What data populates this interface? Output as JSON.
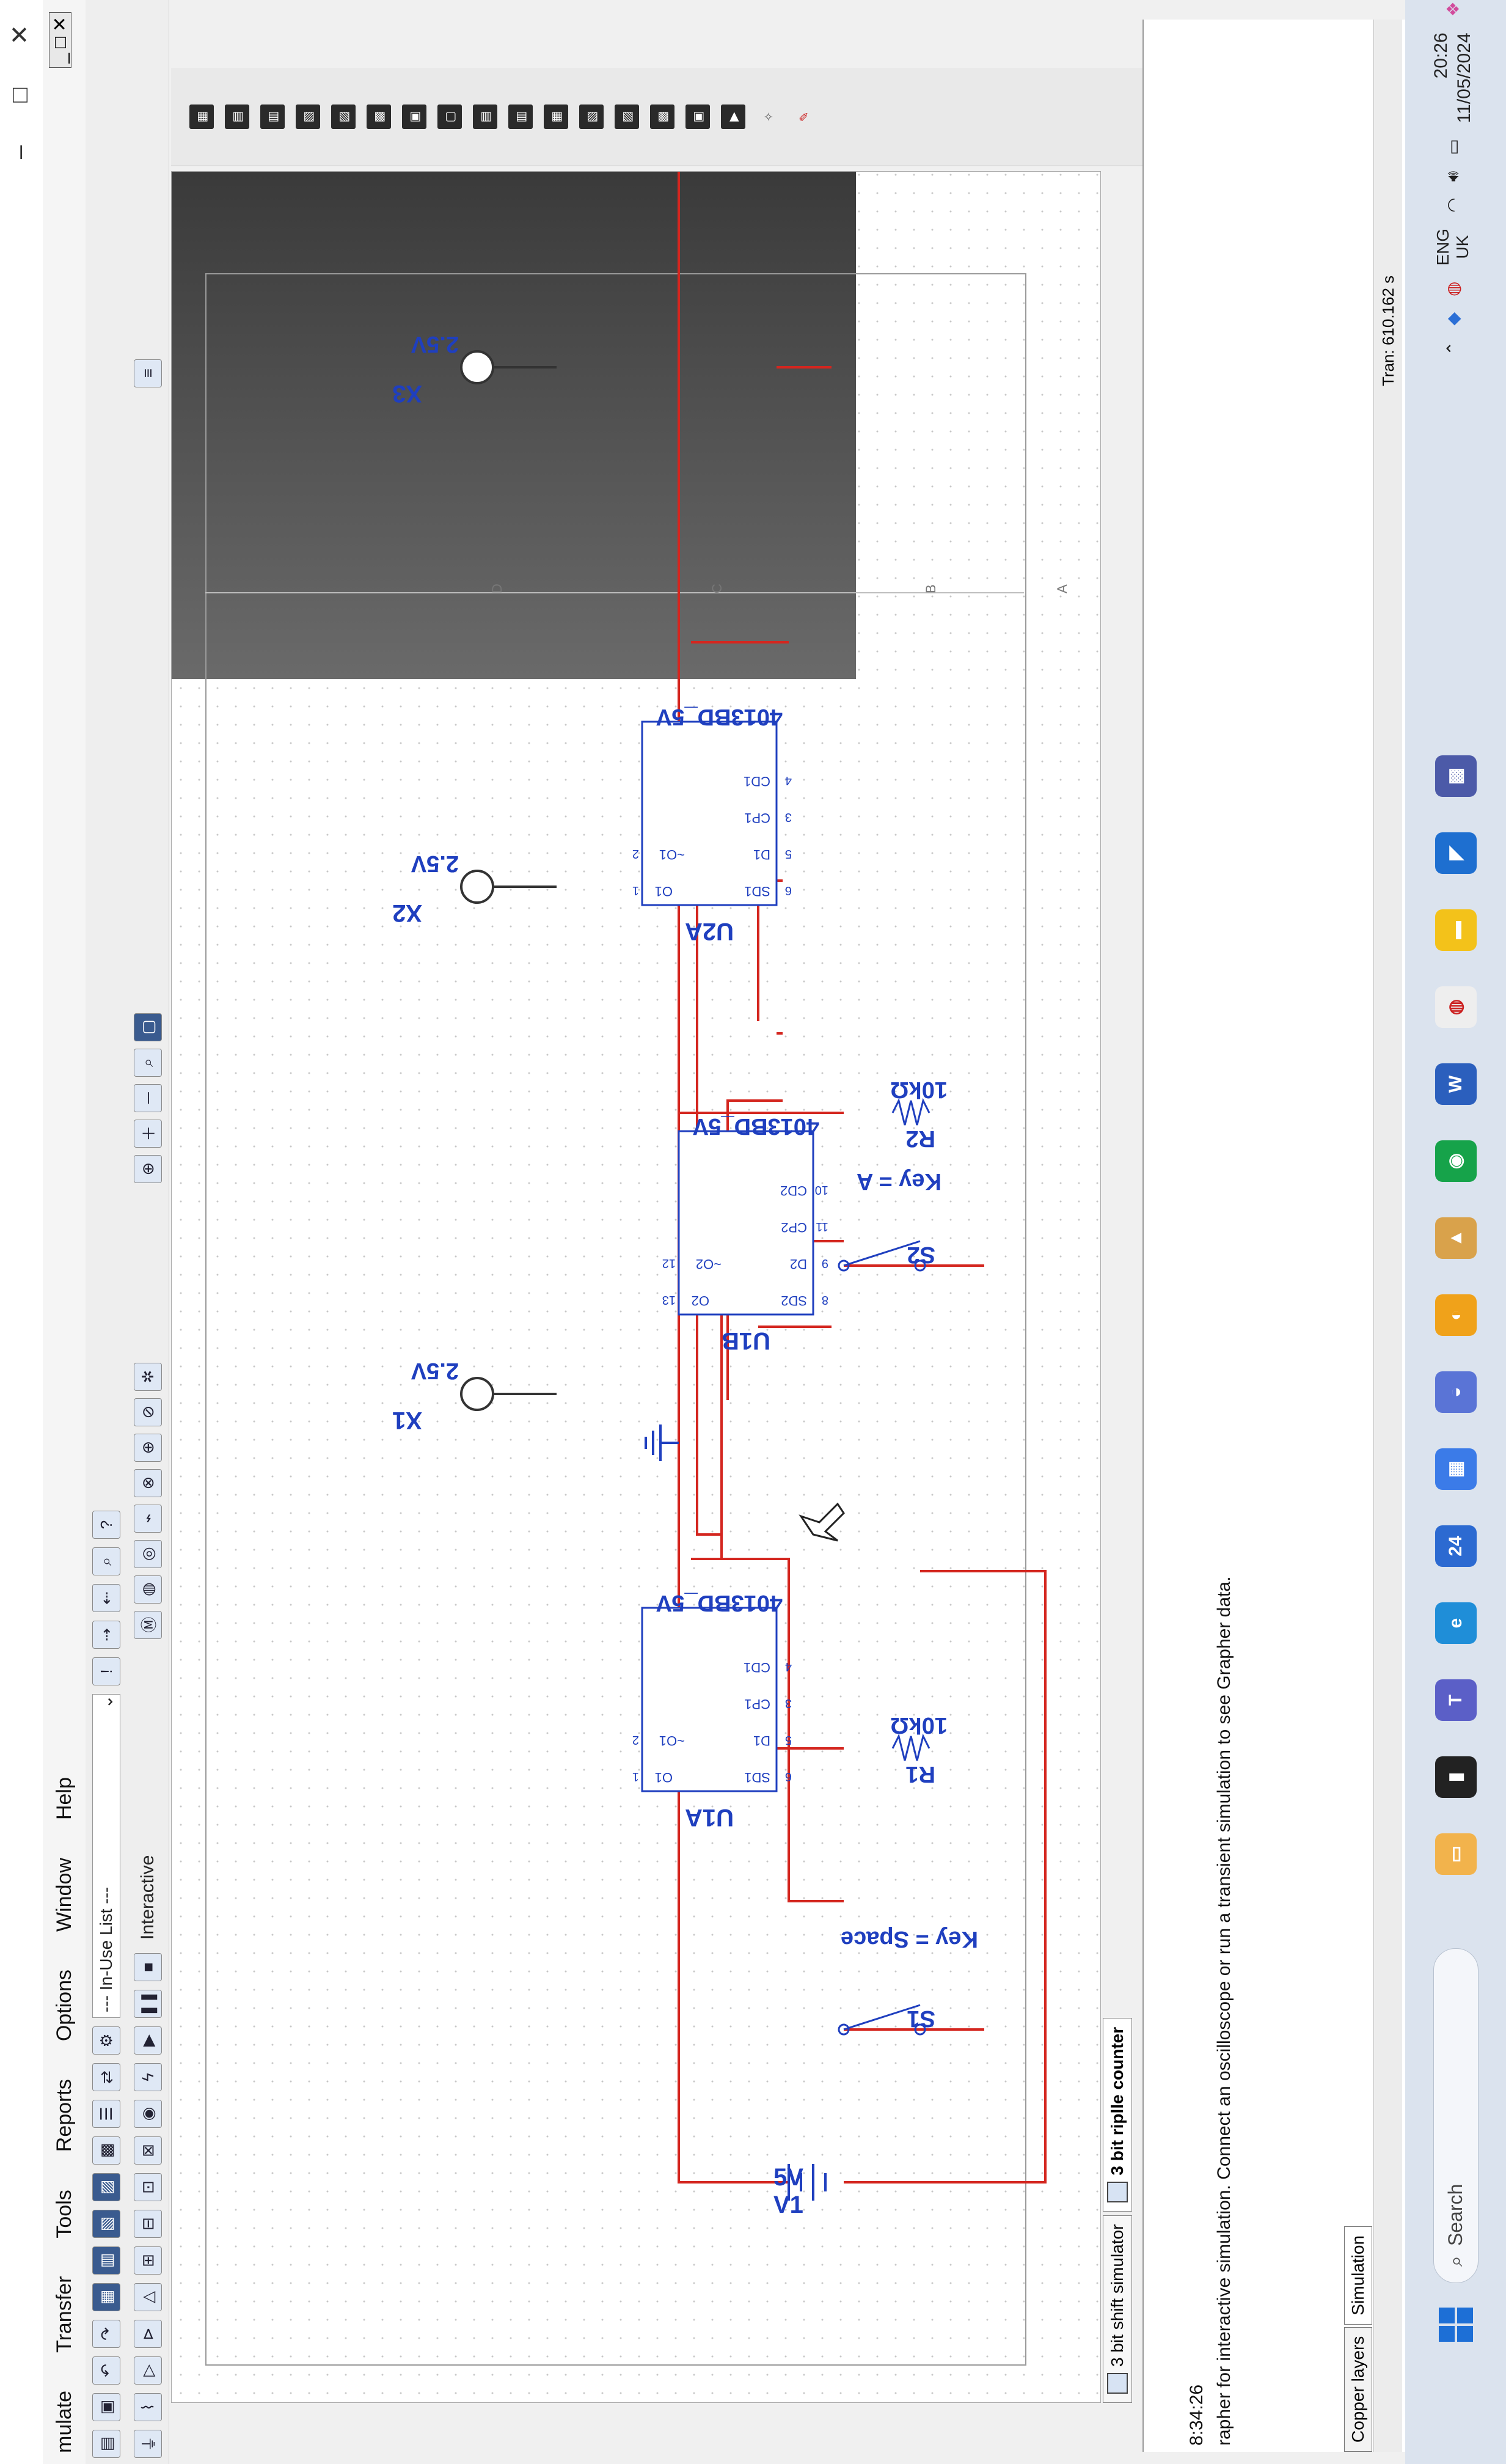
{
  "window": {
    "controls": [
      "–",
      "□",
      "✕"
    ],
    "mdi_controls": "_ □ ✕"
  },
  "menu": [
    "mulate",
    "Transfer",
    "Tools",
    "Reports",
    "Options",
    "Window",
    "Help"
  ],
  "toolbar": {
    "in_use_list": "--- In-Use List ---",
    "interactive_label": "Interactive"
  },
  "schematic": {
    "sources": [
      {
        "name": "V1",
        "value": "5V"
      }
    ],
    "switches": [
      {
        "name": "S1",
        "key": "Key = Space"
      },
      {
        "name": "S2",
        "key": "Key = A"
      }
    ],
    "resistors": [
      {
        "name": "R1",
        "value": "10kΩ"
      },
      {
        "name": "R2",
        "value": "10kΩ"
      }
    ],
    "flipflops": [
      {
        "name": "U1A",
        "part": "4013BD_5V",
        "pins": {
          "sd": "SD1",
          "d": "D1",
          "cp": "CP1",
          "cd": "CD1",
          "q": "O1",
          "qn": "~O1"
        },
        "pin_nums": [
          "6",
          "5",
          "3",
          "4",
          "1",
          "2"
        ]
      },
      {
        "name": "U1B",
        "part": "4013BD_5V",
        "pins": {
          "sd": "SD2",
          "d": "D2",
          "cp": "CP2",
          "cd": "CD2",
          "q": "O2",
          "qn": "~O2"
        },
        "pin_nums": [
          "8",
          "9",
          "11",
          "10",
          "13",
          "12"
        ]
      },
      {
        "name": "U2A",
        "part": "4013BD_5V",
        "pins": {
          "sd": "SD1",
          "d": "D1",
          "cp": "CP1",
          "cd": "CD1",
          "q": "O1",
          "qn": "~O1"
        },
        "pin_nums": [
          "6",
          "5",
          "3",
          "4",
          "1",
          "2"
        ]
      }
    ],
    "probes": [
      {
        "name": "X1",
        "value": "2.5V"
      },
      {
        "name": "X2",
        "value": "2.5V"
      },
      {
        "name": "X3",
        "value": "2.5V"
      }
    ],
    "zones": [
      "A",
      "B",
      "C",
      "D"
    ],
    "wire_color": "#d4261f",
    "component_color": "#1f3fbf"
  },
  "tabs": [
    {
      "label": "3 bit shift simulator",
      "active": false
    },
    {
      "label": "3 bit riplle counter",
      "active": true
    }
  ],
  "output": {
    "time": "8:34:26",
    "message": "rapher for interactive simulation. Connect an oscilloscope or run a transient simulation to see Grapher data."
  },
  "bottom_tabs": [
    "Copper layers",
    "Simulation"
  ],
  "status": {
    "tran": "Tran: 610.162 s"
  },
  "taskbar": {
    "search_placeholder": "Search",
    "lang": "ENG",
    "region": "UK",
    "time": "20:26",
    "date": "11/05/2024",
    "badge": "24"
  }
}
